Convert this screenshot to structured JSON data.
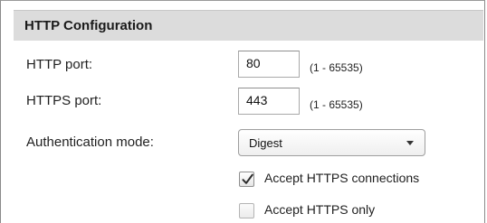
{
  "panel": {
    "title": "HTTP Configuration"
  },
  "http_port": {
    "label": "HTTP port:",
    "value": "80",
    "range": "(1 - 65535)"
  },
  "https_port": {
    "label": "HTTPS port:",
    "value": "443",
    "range": "(1 - 65535)"
  },
  "auth_mode": {
    "label": "Authentication mode:",
    "selected": "Digest",
    "icon": "chevron-down-icon"
  },
  "accept_https_connections": {
    "label": "Accept HTTPS connections",
    "checked": true,
    "icon": "checkmark-icon"
  },
  "accept_https_only": {
    "label": "Accept HTTPS only",
    "checked": false
  }
}
